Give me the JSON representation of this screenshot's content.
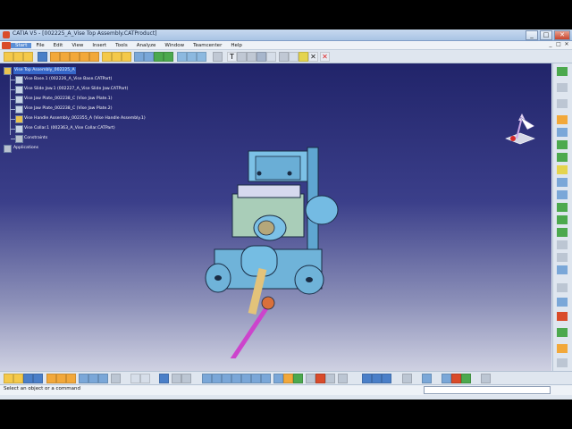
{
  "window": {
    "title": "CATIA V5 - [002225_A_Vise Top Assembly.CATProduct]",
    "controls": {
      "minimize": "_",
      "maximize": "□",
      "close": "✕"
    }
  },
  "menubar": {
    "items": [
      "Start",
      "File",
      "Edit",
      "View",
      "Insert",
      "Tools",
      "Analyze",
      "Window",
      "Teamcenter",
      "Help"
    ],
    "doc_controls": {
      "minimize": "_",
      "restore": "□",
      "close": "✕"
    }
  },
  "tree": {
    "root": "Vise Top Assembly_002225_A",
    "items": [
      "Vise Base.1 (002226_A_Vise Base.CATPart)",
      "Vise Slide Jaw.1 (002227_A_Vise Slide Jaw.CATPart)",
      "Vise Jaw Plate_002238_C (Vise Jaw Plate.1)",
      "Vise Jaw Plate_002238_C (Vise Jaw Plate.2)",
      "Vise Handle Assembly_002355_A (Vise Handle Assembly.1)",
      "Vise Collar.1 (002363_A_Vise Collar.CATPart)",
      "Constraints",
      "Applications"
    ]
  },
  "statusbar": {
    "prompt": "Select an object or a command",
    "command_input": ""
  },
  "icons": {
    "compass": "compass-icon",
    "axis": "xyz-axis-icon"
  },
  "colors": {
    "viewport_top": "#21246a",
    "viewport_bottom": "#cfd1e2",
    "part_blue": "#6fb3d9",
    "handle_magenta": "#cc44cc",
    "knob_orange": "#d9703a"
  }
}
